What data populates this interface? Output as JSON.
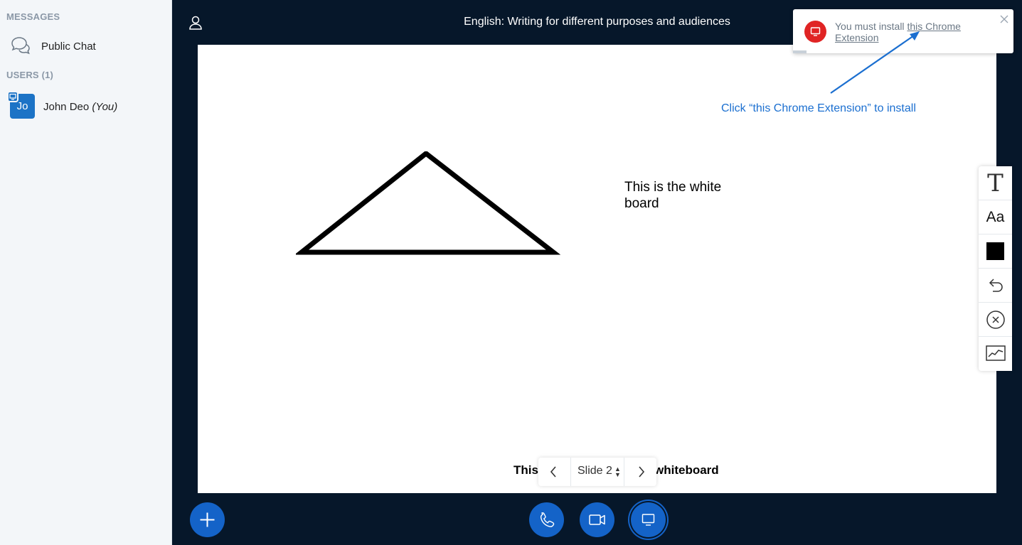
{
  "sidebar": {
    "messages_title": "MESSAGES",
    "public_chat_label": "Public Chat",
    "users_title": "USERS (1)",
    "users": [
      {
        "initials": "Jo",
        "name": "John Deo",
        "suffix": "(You)"
      }
    ]
  },
  "header": {
    "title": "English: Writing for different purposes and audiences"
  },
  "whiteboard": {
    "text": "This is the white board",
    "caption_left": "This",
    "caption_right": "whiteboard"
  },
  "slide_nav": {
    "current": "Slide 2"
  },
  "toolbar": {
    "text_tool": "T",
    "font_size_tool": "Aa",
    "color": "#000000"
  },
  "toast": {
    "message": "You must install",
    "link_text": "this Chrome Extension"
  },
  "annotation": {
    "text": "Click “this Chrome Extension” to install",
    "color": "#1B6FD0"
  },
  "colors": {
    "background": "#06172A",
    "accent": "#1463C8",
    "alert": "#E02424"
  }
}
